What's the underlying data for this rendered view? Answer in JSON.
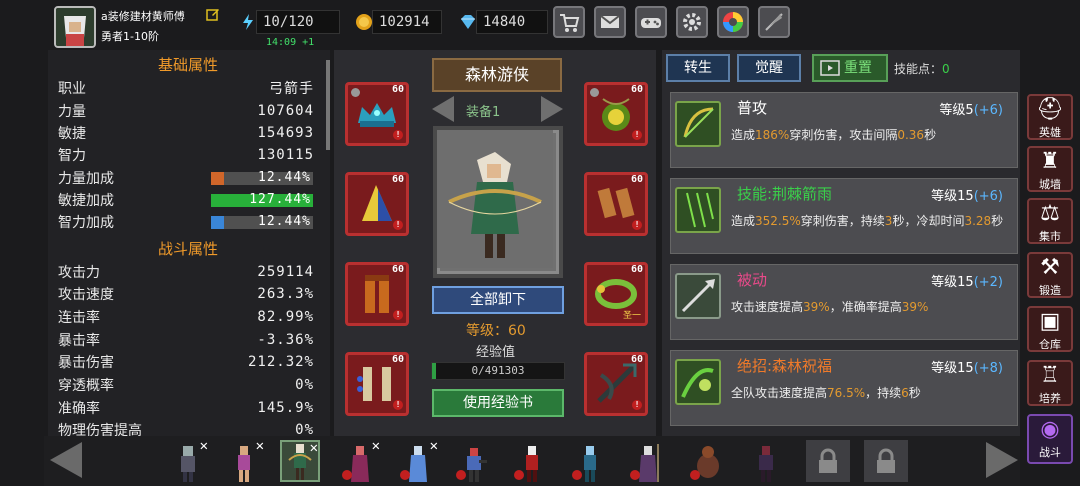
{
  "player": {
    "name": "a装修建材黄师傅",
    "rank": "勇者1-10阶",
    "timer": "14:09 +1"
  },
  "resources": {
    "energy": "10/120",
    "gold": "102914",
    "gems": "14840"
  },
  "top_buttons": [
    "shop-icon",
    "mail-icon",
    "gamepad-icon",
    "gear-icon",
    "shutter-icon",
    "feather-icon"
  ],
  "left": {
    "basic_title": "基础属性",
    "job_label": "职业",
    "job_value": "弓箭手",
    "str_label": "力量",
    "str_value": "107604",
    "agi_label": "敏捷",
    "agi_value": "154693",
    "int_label": "智力",
    "int_value": "130115",
    "str_bonus_label": "力量加成",
    "str_bonus": "12.44%",
    "str_bonus_pct": 12.44,
    "agi_bonus_label": "敏捷加成",
    "agi_bonus": "127.44%",
    "agi_bonus_pct": 127.44,
    "int_bonus_label": "智力加成",
    "int_bonus": "12.44%",
    "int_bonus_pct": 12.44,
    "battle_title": "战斗属性",
    "atk_label": "攻击力",
    "atk": "259114",
    "atkspd_label": "攻击速度",
    "atkspd": "263.3%",
    "combo_label": "连击率",
    "combo": "82.99%",
    "crit_label": "暴击率",
    "crit": "-3.36%",
    "critdmg_label": "暴击伤害",
    "critdmg": "212.32%",
    "pierce_label": "穿透概率",
    "pierce": "0%",
    "acc_label": "准确率",
    "acc": "145.9%",
    "phys_label": "物理伤害提高",
    "phys": "0%"
  },
  "center": {
    "class_title": "森林游侠",
    "set_label": "装备1",
    "slot_level": "60",
    "slot_tag": "圣一",
    "unequip": "全部卸下",
    "level_text": "等级：60",
    "exp_label": "经验值",
    "exp_text": "0/491303",
    "use_book": "使用经验书"
  },
  "right": {
    "tab1": "转生",
    "tab2": "觉醒",
    "reset": "重置",
    "points_label": "技能点：",
    "points": "0",
    "skills": [
      {
        "name": "普攻",
        "level": "等级5",
        "plus": "(+6)",
        "d1": "造成",
        "h1": "186%",
        "d2": "穿刺伤害，攻击间隔",
        "h2": "0.36",
        "d3": "秒"
      },
      {
        "name": "技能:荆棘箭雨",
        "level": "等级15",
        "plus": "(+6)",
        "d1": "造成",
        "h1": "352.5%",
        "d2": "穿刺伤害，持续",
        "h2": "3",
        "d3": "秒，冷却时间",
        "h3": "3.28",
        "d4": "秒"
      },
      {
        "name": "被动",
        "level": "等级15",
        "plus": "(+2)",
        "d1": "攻击速度提高",
        "h1": "39%",
        "d2": "，准确率提高",
        "h2": "39%"
      },
      {
        "name": "绝招:森林祝福",
        "level": "等级15",
        "plus": "(+8)",
        "d1": "全队攻击速度提高",
        "h1": "76.5%",
        "d2": "，持续",
        "h2": "6",
        "d3": "秒"
      }
    ]
  },
  "nav": [
    "英雄",
    "城墙",
    "集市",
    "锻造",
    "仓库",
    "培养",
    "战斗"
  ],
  "colors": {
    "accent_orange": "#e39a2f",
    "green": "#42e06a",
    "blue": "#5bb7ff",
    "panel": "#222225"
  }
}
